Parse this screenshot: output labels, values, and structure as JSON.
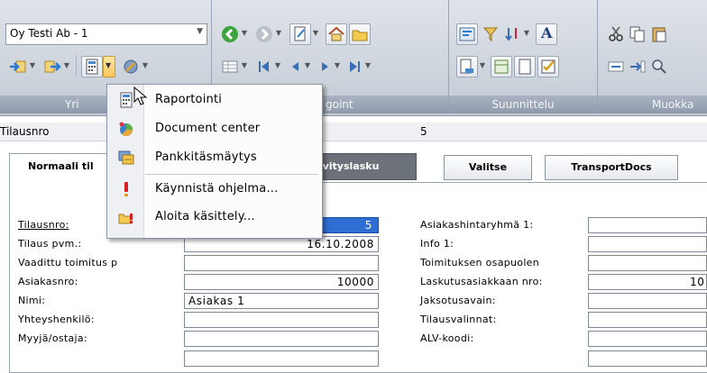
{
  "ribbon": {
    "company_combo": "Oy Testi Ab - 1",
    "groups": [
      "Yri",
      "goint",
      "Suunnittelu",
      "Muokka"
    ]
  },
  "field_row": {
    "label": "Tilausnro",
    "value": "5"
  },
  "tabs": {
    "normal": "Normaali til",
    "other": "vityslasku"
  },
  "buttons": {
    "select": "Valitse",
    "transport": "TransportDocs"
  },
  "menu": {
    "items": [
      {
        "label": "Raportointi",
        "icon": "report-icon"
      },
      {
        "label": "Document center",
        "icon": "document-center-icon"
      },
      {
        "label": "Pankkitäsmäytys",
        "icon": "bank-reconcile-icon"
      },
      {
        "label": "Käynnistä ohjelma...",
        "icon": "exclamation-icon"
      },
      {
        "label": "Aloita käsittely...",
        "icon": "start-processing-icon"
      }
    ]
  },
  "form": {
    "left": [
      {
        "label": "Tilausnro:",
        "value": "5"
      },
      {
        "label": "Tilaus pvm.:",
        "value": "16.10.2008"
      },
      {
        "label": "Vaadittu toimitus p",
        "value": ""
      },
      {
        "label": "Asiakasnro:",
        "value": "10000"
      },
      {
        "label": "Nimi:",
        "value": "Asiakas 1"
      },
      {
        "label": "Yhteyshenkilö:",
        "value": ""
      },
      {
        "label": "Myyjä/ostaja:",
        "value": ""
      }
    ],
    "right": [
      {
        "label": "Asiakashintaryhmä 1:",
        "value": ""
      },
      {
        "label": "Info 1:",
        "value": ""
      },
      {
        "label": "Toimituksen osapuolen",
        "value": ""
      },
      {
        "label": "Laskutusasiakkaan nro:",
        "value": "10"
      },
      {
        "label": "Jaksotusavain:",
        "value": ""
      },
      {
        "label": "Tilausvalinnat:",
        "value": ""
      },
      {
        "label": "ALV-koodi:",
        "value": ""
      }
    ]
  },
  "colors": {
    "ribbon": "#cfd5dd",
    "menu_highlight": "#ffc75a",
    "tab_dark": "#6d727a"
  }
}
